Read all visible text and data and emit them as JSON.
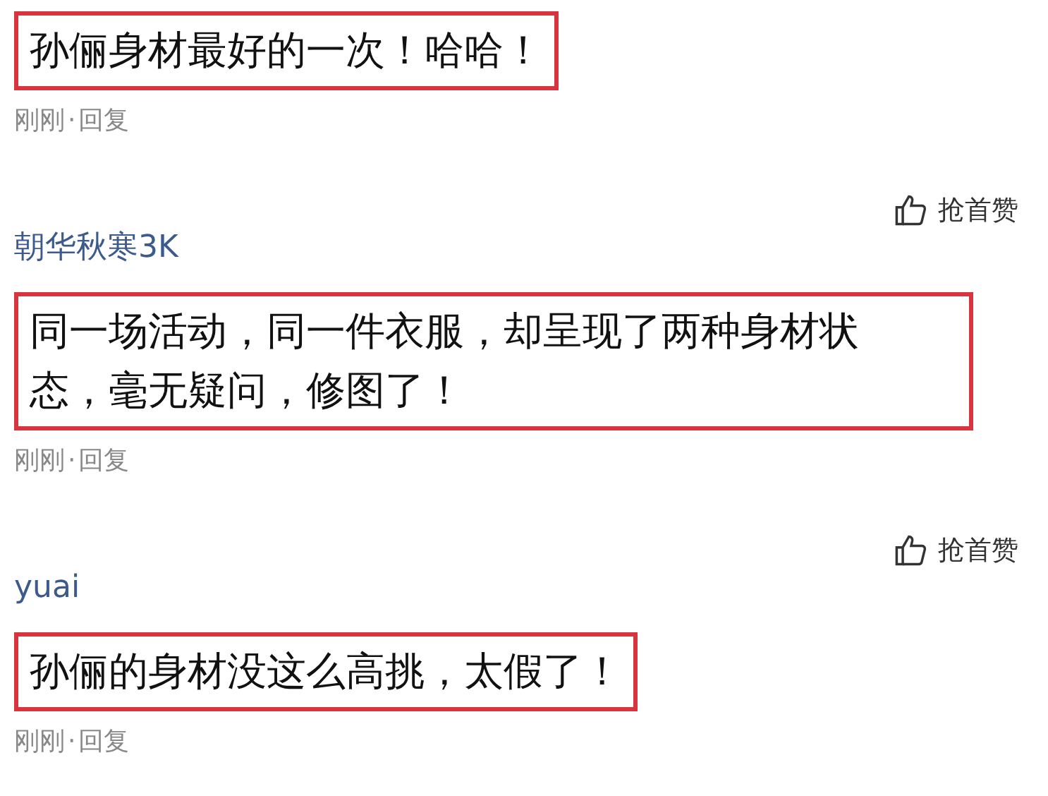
{
  "comments": [
    {
      "text": "孙俪身材最好的一次！哈哈！",
      "time": "刚刚",
      "separator": "·",
      "reply": "回复"
    },
    {
      "username": "朝华秋寒3K",
      "like_label": "抢首赞",
      "text": "同一场活动，同一件衣服，却呈现了两种身材状态，毫无疑问，修图了！",
      "time": "刚刚",
      "separator": "·",
      "reply": "回复"
    },
    {
      "username": "yuai",
      "like_label": "抢首赞",
      "text": "孙俪的身材没这么高挑，太假了！",
      "time": "刚刚",
      "separator": "·",
      "reply": "回复"
    }
  ]
}
